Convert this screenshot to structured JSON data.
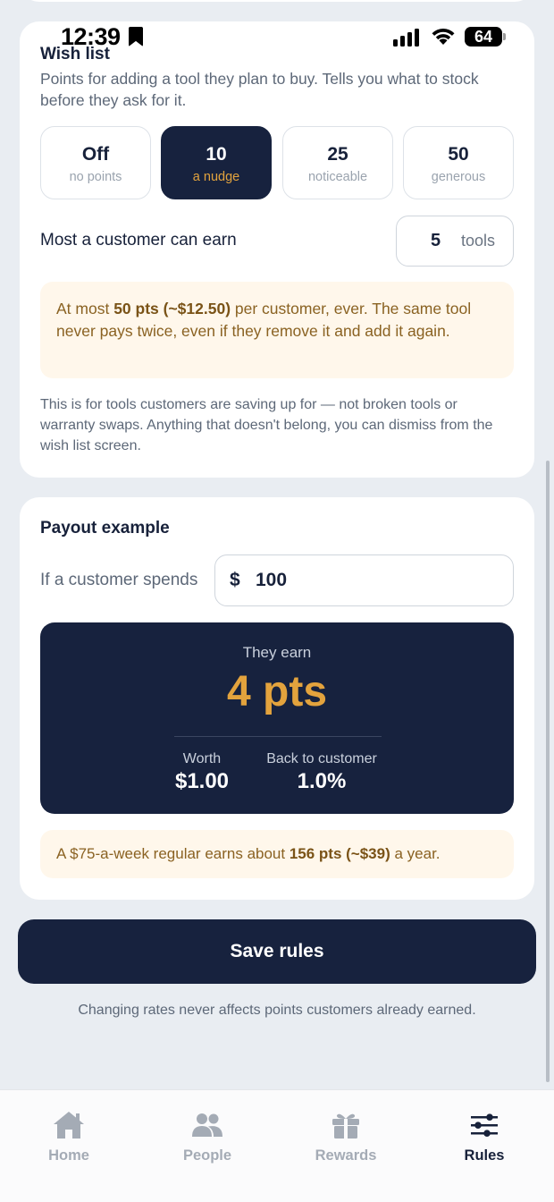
{
  "status": {
    "time": "12:39",
    "battery": "64"
  },
  "wish": {
    "title": "Wish list",
    "description": "Points for adding a tool they plan to buy. Tells you what to stock before they ask for it.",
    "options": [
      {
        "value": "Off",
        "sub": "no points",
        "selected": false
      },
      {
        "value": "10",
        "sub": "a nudge",
        "selected": true
      },
      {
        "value": "25",
        "sub": "noticeable",
        "selected": false
      },
      {
        "value": "50",
        "sub": "generous",
        "selected": false
      }
    ],
    "max_label": "Most a customer can earn",
    "max_value": "5",
    "max_unit": "tools",
    "note_prefix": "At most ",
    "note_bold": "50 pts (~$12.50)",
    "note_suffix": " per customer, ever. The same tool never pays twice, even if they remove it and add it again.",
    "footer": "This is for tools customers are saving up for — not broken tools or warranty swaps. Anything that doesn't belong, you can dismiss from the wish list screen."
  },
  "payout": {
    "title": "Payout example",
    "spend_label": "If a customer spends",
    "currency": "$",
    "spend_value": "100",
    "earn_label": "They earn",
    "earn_points": "4 pts",
    "worth_label": "Worth",
    "worth_value": "$1.00",
    "back_label": "Back to customer",
    "back_value": "1.0%",
    "note_prefix": "A $75-a-week regular earns about ",
    "note_bold": "156 pts (~$39)",
    "note_suffix": " a year."
  },
  "save": {
    "label": "Save rules",
    "footer": "Changing rates never affects points customers already earned."
  },
  "tabs": [
    {
      "label": "Home",
      "icon": "home-icon",
      "active": false
    },
    {
      "label": "People",
      "icon": "people-icon",
      "active": false
    },
    {
      "label": "Rewards",
      "icon": "gift-icon",
      "active": false
    },
    {
      "label": "Rules",
      "icon": "sliders-icon",
      "active": true
    }
  ],
  "colors": {
    "navy": "#17223e",
    "accent": "#e3a33d",
    "note_bg": "#fff7eb"
  }
}
